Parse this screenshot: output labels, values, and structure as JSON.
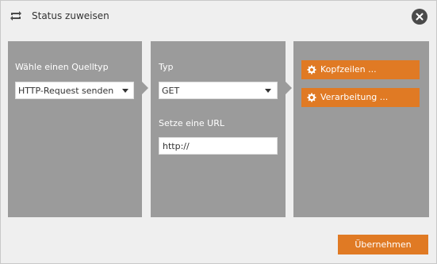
{
  "dialog": {
    "title": "Status zuweisen",
    "title_icon": "repeat-icon",
    "close_icon": "close-icon"
  },
  "source_panel": {
    "label": "Wähle einen Quelltyp",
    "source_type_value": "HTTP-Request senden"
  },
  "request_panel": {
    "type_label": "Typ",
    "type_value": "GET",
    "url_label": "Setze eine URL",
    "url_value": "http://"
  },
  "options_panel": {
    "headers_button": "Kopfzeilen ...",
    "processing_button": "Verarbeitung ...",
    "button_icon": "gear-icon"
  },
  "footer": {
    "apply_button": "Übernehmen"
  },
  "colors": {
    "accent": "#e07a24",
    "panel": "#9b9b9b",
    "background": "#efefef"
  }
}
